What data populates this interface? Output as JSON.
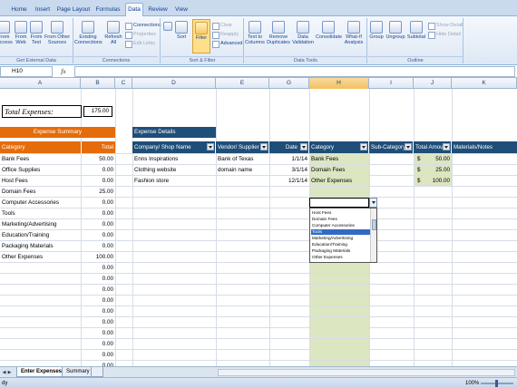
{
  "ribbon": {
    "tabs": [
      "Home",
      "Insert",
      "Page Layout",
      "Formulas",
      "Data",
      "Review",
      "View"
    ],
    "active_tab": "Data",
    "get_external_data": {
      "label": "Get External Data",
      "from_access": "From\nAccess",
      "from_web": "From\nWeb",
      "from_text": "From\nText",
      "from_other": "From Other\nSources"
    },
    "connections": {
      "label": "Connections",
      "existing": "Existing\nConnections",
      "refresh_all": "Refresh\nAll",
      "connections_btn": "Connections",
      "properties": "Properties",
      "edit_links": "Edit Links"
    },
    "sort_filter": {
      "label": "Sort & Filter",
      "sort_az": "A→Z",
      "sort": "Sort",
      "filter": "Filter",
      "clear": "Clear",
      "reapply": "Reapply",
      "advanced": "Advanced"
    },
    "data_tools": {
      "label": "Data Tools",
      "text_to_columns": "Text to\nColumns",
      "remove_duplicates": "Remove\nDuplicates",
      "data_validation": "Data\nValidation",
      "consolidate": "Consolidate",
      "what_if": "What-If\nAnalysis"
    },
    "outline": {
      "label": "Outline",
      "group": "Group",
      "ungroup": "Ungroup",
      "subtotal": "Subtotal",
      "show_detail": "Show Detail",
      "hide_detail": "Hide Detail"
    }
  },
  "formula_bar": {
    "name_box": "H10",
    "fx": "fx",
    "formula": ""
  },
  "columns": [
    "A",
    "B",
    "C",
    "D",
    "E",
    "F",
    "G",
    "H",
    "I",
    "J",
    "K"
  ],
  "selected_column": "H",
  "total": {
    "label": "Total Expenses:",
    "value": "175.00"
  },
  "summary": {
    "title": "Expense Summary",
    "col_category": "Category",
    "col_total": "Total",
    "rows": [
      {
        "category": "Bank Fees",
        "total": "50.00"
      },
      {
        "category": "Office Supplies",
        "total": "0.00"
      },
      {
        "category": "Host Fees",
        "total": "0.00"
      },
      {
        "category": "Domain Fees",
        "total": "25.00"
      },
      {
        "category": "Computer Accessories",
        "total": "0.00"
      },
      {
        "category": "Tools",
        "total": "0.00"
      },
      {
        "category": "Marketing/Advertising",
        "total": "0.00"
      },
      {
        "category": "Education/Training",
        "total": "0.00"
      },
      {
        "category": "Packaging Materials",
        "total": "0.00"
      },
      {
        "category": "Other Expenses",
        "total": "100.00"
      }
    ],
    "empty_totals": [
      "0.00",
      "0.00",
      "0.00",
      "0.00",
      "0.00",
      "0.00",
      "0.00",
      "0.00",
      "0.00",
      "0.00",
      "0.00"
    ]
  },
  "details": {
    "title": "Expense Details",
    "headers": {
      "company": "Company/ Shop Name",
      "vendor": "Vendor/ Supplier",
      "date": "Date",
      "category": "Category",
      "subcategory": "Sub-Category",
      "total_amount": "Total Amou",
      "materials": "Materials/Notes"
    },
    "rows": [
      {
        "company": "Enns Inspirations",
        "vendor": "Bank of Texas",
        "date": "1/1/14",
        "category": "Bank Fees",
        "currency": "$",
        "amount": "50.00"
      },
      {
        "company": "Clothing website",
        "vendor": "domain name",
        "date": "3/1/14",
        "category": "Domain Fees",
        "currency": "$",
        "amount": "25.00"
      },
      {
        "company": "Fashion store",
        "vendor": "",
        "date": "12/1/14",
        "category": "Other Expenses",
        "currency": "$",
        "amount": "100.00"
      }
    ]
  },
  "dropdown": {
    "items": [
      "Host Fees",
      "Domain Fees",
      "Computer Accessories",
      "Tools",
      "Marketing/Advertising",
      "Education/Training",
      "Packaging Materials",
      "Other Expenses"
    ],
    "selected": "Tools"
  },
  "sheets": {
    "tabs": [
      "Enter Expenses",
      "Summary"
    ],
    "active": "Enter Expenses"
  },
  "status": {
    "text": "dy",
    "zoom": "100%"
  },
  "colors": {
    "summary_orange": "#e46c0a",
    "details_navy": "#1f4e79",
    "category_green": "#dce6c1"
  }
}
